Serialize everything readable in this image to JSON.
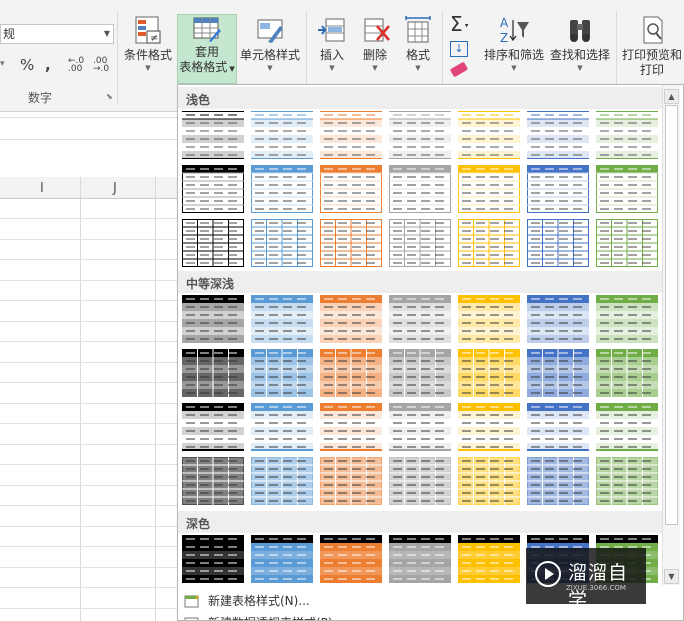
{
  "ribbon": {
    "number_format_value": "规",
    "percent_symbol": "%",
    "comma_symbol": ",",
    "increase_decimal": "←.0\n.00",
    "decrease_decimal": ".00\n→.0",
    "number_group_label": "数字",
    "conditional_format_label": "条件格式",
    "format_as_table_label_1": "套用",
    "format_as_table_label_2": "表格格式",
    "cell_styles_label": "单元格样式",
    "insert_label": "插入",
    "delete_label": "删除",
    "format_label": "格式",
    "sort_filter_label": "排序和筛选",
    "find_select_label": "查找和选择",
    "print_preview_label_1": "打印预览和",
    "print_preview_label_2": "打印"
  },
  "sheet": {
    "col_i": "I",
    "col_j": "J"
  },
  "gallery": {
    "light_label": "浅色",
    "medium_label": "中等深浅",
    "dark_label": "深色",
    "new_table_style": "新建表格样式(N)...",
    "new_pivot_style": "新建数据透视表样式(P)..."
  },
  "colors": {
    "black": "#000000",
    "blue": "#5b9bd5",
    "orange": "#ed7d31",
    "gray": "#a5a5a5",
    "gold": "#ffc000",
    "navy": "#4472c4",
    "green": "#70ad47",
    "ribbon_active": "#c5e6cf"
  },
  "watermark": {
    "title": "溜溜自学",
    "sub": "ZIXUE.3066.COM"
  }
}
